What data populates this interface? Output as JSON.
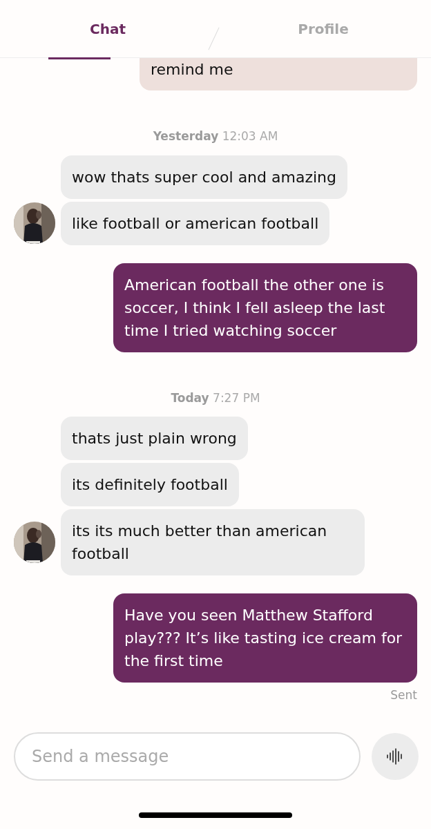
{
  "tabs": [
    {
      "label": "Chat",
      "selected": true
    },
    {
      "label": "Profile",
      "selected": false
    }
  ],
  "messages": [
    {
      "kind": "sent",
      "text": "remind me",
      "pending": true
    },
    {
      "kind": "time",
      "text": "**Yesterday** 12:03 AM"
    },
    {
      "kind": "received",
      "text": "wow thats super cool and amazing",
      "show_avatar": false
    },
    {
      "kind": "received",
      "text": "like football or american football",
      "show_avatar": true
    },
    {
      "kind": "sent",
      "text": "American football the other one is soccer, I think I fell asleep the last time I tried watching soccer",
      "pending": false
    },
    {
      "kind": "time",
      "text": "**Today** 7:27 PM"
    },
    {
      "kind": "received",
      "text": "thats just plain wrong",
      "show_avatar": false
    },
    {
      "kind": "received",
      "text": "its definitely football",
      "show_avatar": false
    },
    {
      "kind": "received",
      "text": "its its much better than american football",
      "show_avatar": true
    },
    {
      "kind": "sent",
      "text": "Have you seen Matthew Stafford play??? It’s like tasting ice cream for the first time",
      "pending": false
    },
    {
      "kind": "status",
      "text": "Sent"
    }
  ],
  "composer": {
    "placeholder": "Send a message"
  }
}
